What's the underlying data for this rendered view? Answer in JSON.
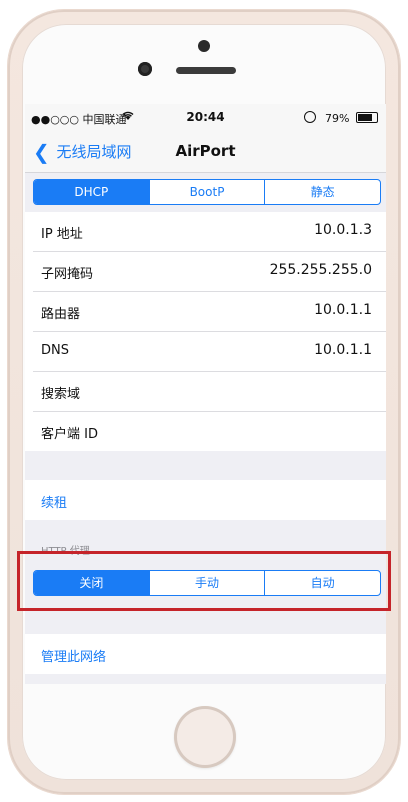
{
  "status_bar": {
    "carrier": "●●○○○ 中国联通 ",
    "time": "20:44",
    "battery": "79%"
  },
  "nav": {
    "back_label": "无线局域网",
    "title": "AirPort"
  },
  "ip_mode_tabs": [
    {
      "label": "DHCP",
      "active": true
    },
    {
      "label": "BootP",
      "active": false
    },
    {
      "label": "静态",
      "active": false
    }
  ],
  "rows": [
    {
      "label": "IP 地址",
      "value": "10.0.1.3"
    },
    {
      "label": "子网掩码",
      "value": "255.255.255.0"
    },
    {
      "label": "路由器",
      "value": "10.0.1.1"
    },
    {
      "label": "DNS",
      "value": "10.0.1.1"
    },
    {
      "label": "搜索域",
      "value": ""
    },
    {
      "label": "客户端 ID",
      "value": ""
    }
  ],
  "renew_label": "续租",
  "proxy_header": "HTTP 代理",
  "proxy_tabs": [
    {
      "label": "关闭",
      "active": true
    },
    {
      "label": "手动",
      "active": false
    },
    {
      "label": "自动",
      "active": false
    }
  ],
  "manage_label": "管理此网络",
  "colors": {
    "accent": "#1a7cf5",
    "highlight_border": "#c5242a"
  }
}
